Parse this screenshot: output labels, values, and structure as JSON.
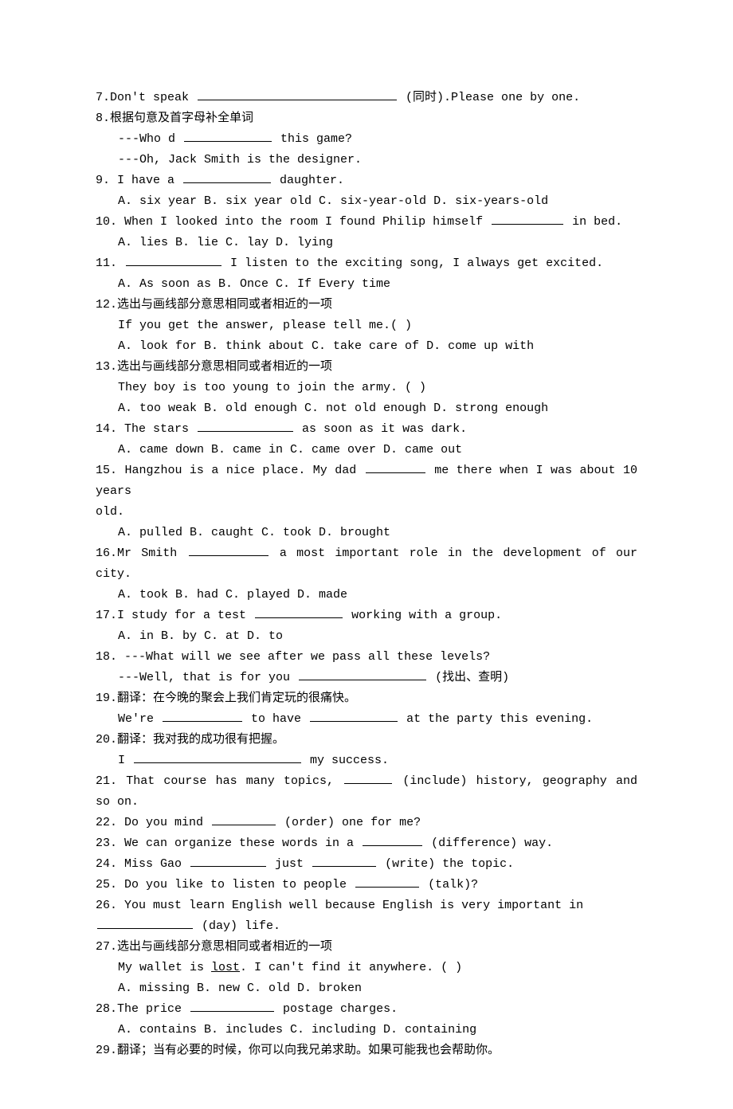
{
  "q7": {
    "text_a": "7.Don't speak ",
    "text_b": " (同时).Please one by one."
  },
  "q8": {
    "line1": "8.根据句意及首字母补全单词",
    "line2_a": "---Who d",
    "line2_b": " this game?",
    "line3": "---Oh, Jack Smith is the designer."
  },
  "q9": {
    "line1_a": "9. I have a ",
    "line1_b": " daughter.",
    "opts": "A. six year    B. six year old    C. six-year-old    D. six-years-old"
  },
  "q10": {
    "line1_a": "10. When I looked into the room I found Philip himself ",
    "line1_b": "in bed.",
    "opts": "A. lies    B. lie    C. lay    D. lying"
  },
  "q11": {
    "line1_a": "11.",
    "line1_b": " I listen to the exciting song, I always get excited.",
    "opts": "A. As soon as    B. Once     C. If    Every time"
  },
  "q12": {
    "line1": "12.选出与画线部分意思相同或者相近的一项",
    "line2": "If you get the answer, please tell me.(    )",
    "opts": "A. look for    B. think about    C. take care of    D. come up with"
  },
  "q13": {
    "line1": "13.选出与画线部分意思相同或者相近的一项",
    "line2": "They boy is too young to join the army. (    )",
    "opts": "A. too weak   B. old enough   C. not old enough   D. strong enough"
  },
  "q14": {
    "line1_a": "14. The stars ",
    "line1_b": "as soon as it was dark.",
    "opts": "A. came down    B. came in    C. came over    D. came out"
  },
  "q15": {
    "line1_a": "15. Hangzhou is a nice place. My dad ",
    "line1_b": "me there when I was about 10 years",
    "line2": "old.",
    "opts": "A. pulled    B. caught    C. took    D. brought"
  },
  "q16": {
    "line1_a": "16.Mr Smith ",
    "line1_b": "a most important role in the development of our city.",
    "opts": "A. took    B. had    C. played    D. made"
  },
  "q17": {
    "line1_a": "17.I study for a test ",
    "line1_b": " working with a group.",
    "opts": "A. in    B. by    C. at    D. to"
  },
  "q18": {
    "line1": "18. ---What will we see after we pass all these levels?",
    "line2_a": "---Well, that is for you ",
    "line2_b": " (找出、查明)"
  },
  "q19": {
    "line1": "19.翻译：在今晚的聚会上我们肯定玩的很痛快。",
    "line2_a": "We're ",
    "line2_b": "to have",
    "line2_c": " at the party this evening."
  },
  "q20": {
    "line1": "20.翻译：我对我的成功很有把握。",
    "line2_a": "I ",
    "line2_b": " my success."
  },
  "q21": {
    "a": "21. That course has many topics, ",
    "b": "(include) history, geography and so on."
  },
  "q22": {
    "a": "22. Do you mind ",
    "b": "(order) one for me?"
  },
  "q23": {
    "a": "23. We can organize these words in a ",
    "b": " (difference) way."
  },
  "q24": {
    "a": "24. Miss Gao ",
    "b": " just ",
    "c": "(write) the topic."
  },
  "q25": {
    "a": "25. Do you like to listen to people ",
    "b": "(talk)?"
  },
  "q26": {
    "a": "26.  You  must  learn  English  well  because  English  is  very  important  in",
    "b": " (day) life."
  },
  "q27": {
    "line1": "27.选出与画线部分意思相同或者相近的一项",
    "line2_a": "My wallet is ",
    "line2_u": "lost",
    "line2_b": ". I can't find it anywhere. (    )",
    "opts": "A. missing    B. new    C. old    D. broken"
  },
  "q28": {
    "a": "28.The price ",
    "b": " postage charges.",
    "opts": "A. contains    B. includes    C. including    D. containing"
  },
  "q29": {
    "line1": "29.翻译；当有必要的时候，你可以向我兄弟求助。如果可能我也会帮助你。"
  }
}
